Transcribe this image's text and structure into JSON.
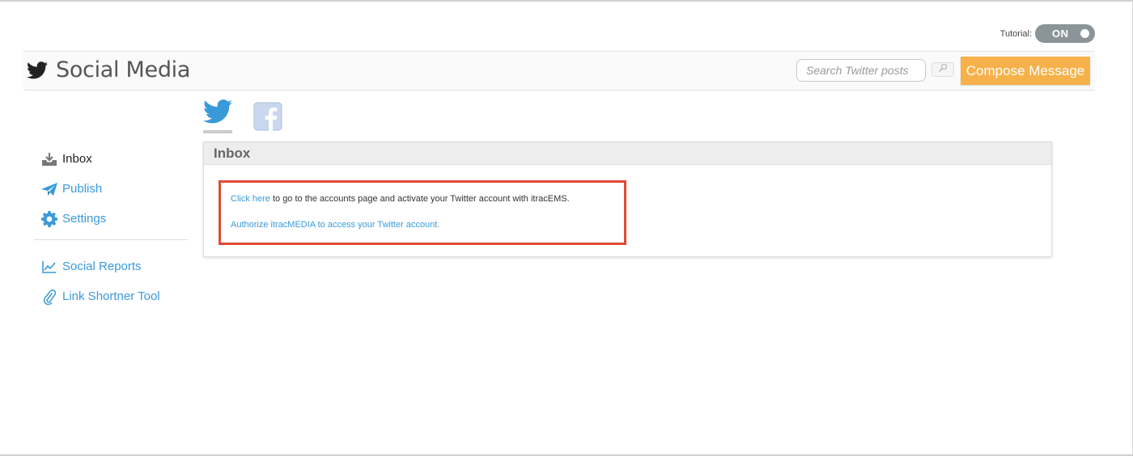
{
  "tutorial": {
    "label": "Tutorial:",
    "toggle_state": "ON"
  },
  "header": {
    "title": "Social Media",
    "brand_icon": "twitter-bird-icon",
    "search": {
      "placeholder": "Search Twitter posts",
      "value": ""
    },
    "search_icon": "search-icon",
    "compose_label": "Compose Message"
  },
  "sidebar": {
    "items": [
      {
        "label": "Inbox",
        "icon": "inbox-icon",
        "active": true
      },
      {
        "label": "Publish",
        "icon": "paper-plane-icon",
        "active": false
      },
      {
        "label": "Settings",
        "icon": "gear-icon",
        "active": false
      }
    ],
    "tools": [
      {
        "label": "Social Reports",
        "icon": "line-chart-icon"
      },
      {
        "label": "Link Shortner Tool",
        "icon": "paperclip-icon"
      }
    ]
  },
  "network_tabs": [
    {
      "name": "Twitter",
      "icon": "twitter-icon",
      "active": true
    },
    {
      "name": "Facebook",
      "icon": "facebook-icon",
      "active": false
    }
  ],
  "panel": {
    "title": "Inbox",
    "notice": {
      "link1": "Click here",
      "text1": " to go to the accounts page and activate your Twitter account with itracEMS.",
      "link2": "Authorize itracMEDIA to access your Twitter account."
    }
  },
  "colors": {
    "accent_blue": "#3a9ad9",
    "compose_orange": "#f7b14a",
    "highlight_red": "#e04a35",
    "toggle_gray": "#8a9499"
  }
}
